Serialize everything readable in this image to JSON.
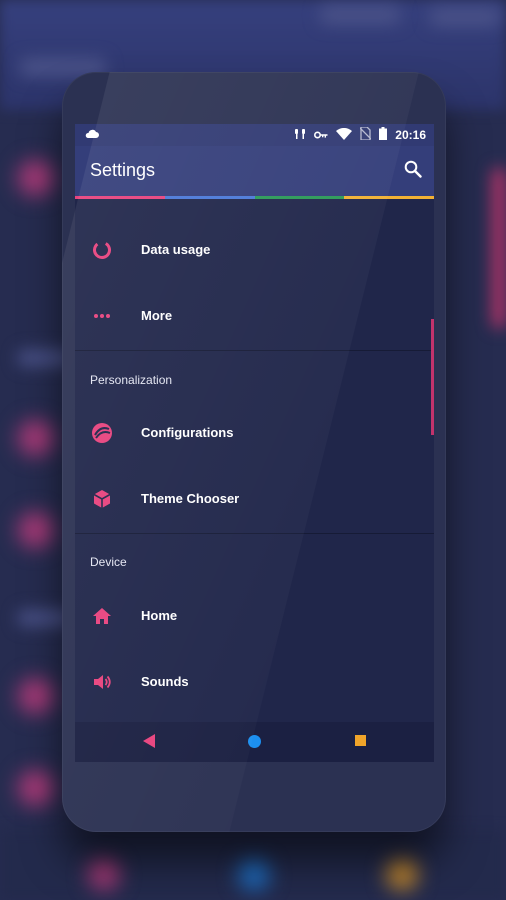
{
  "status_bar": {
    "time": "20:16",
    "icons": [
      "cloud-icon",
      "headphones-icon",
      "key-icon",
      "wifi-icon",
      "no-sim-icon",
      "battery-icon"
    ]
  },
  "app_bar": {
    "title": "Settings",
    "search_icon": "search-icon"
  },
  "colors": {
    "accent": "#e8437e",
    "app_bar": "#343e7a",
    "status_bar": "#313a73",
    "background": "#20264a",
    "stripe": [
      "#e8437e",
      "#4b79d8",
      "#2b9a58",
      "#f2b134"
    ],
    "nav_home": "#1c8ff0",
    "nav_recent": "#f0a42a"
  },
  "sections": [
    {
      "header": "",
      "items": [
        {
          "label": "Data usage",
          "icon": "data-usage-icon"
        },
        {
          "label": "More",
          "icon": "more-dots-icon"
        }
      ]
    },
    {
      "header": "Personalization",
      "items": [
        {
          "label": "Configurations",
          "icon": "configurations-icon"
        },
        {
          "label": "Theme Chooser",
          "icon": "theme-chooser-icon"
        }
      ]
    },
    {
      "header": "Device",
      "items": [
        {
          "label": "Home",
          "icon": "home-icon"
        },
        {
          "label": "Sounds",
          "icon": "sounds-icon"
        }
      ]
    }
  ],
  "nav_bar": {
    "back": "back-triangle-icon",
    "home": "home-circle-icon",
    "recent": "recents-square-icon"
  }
}
